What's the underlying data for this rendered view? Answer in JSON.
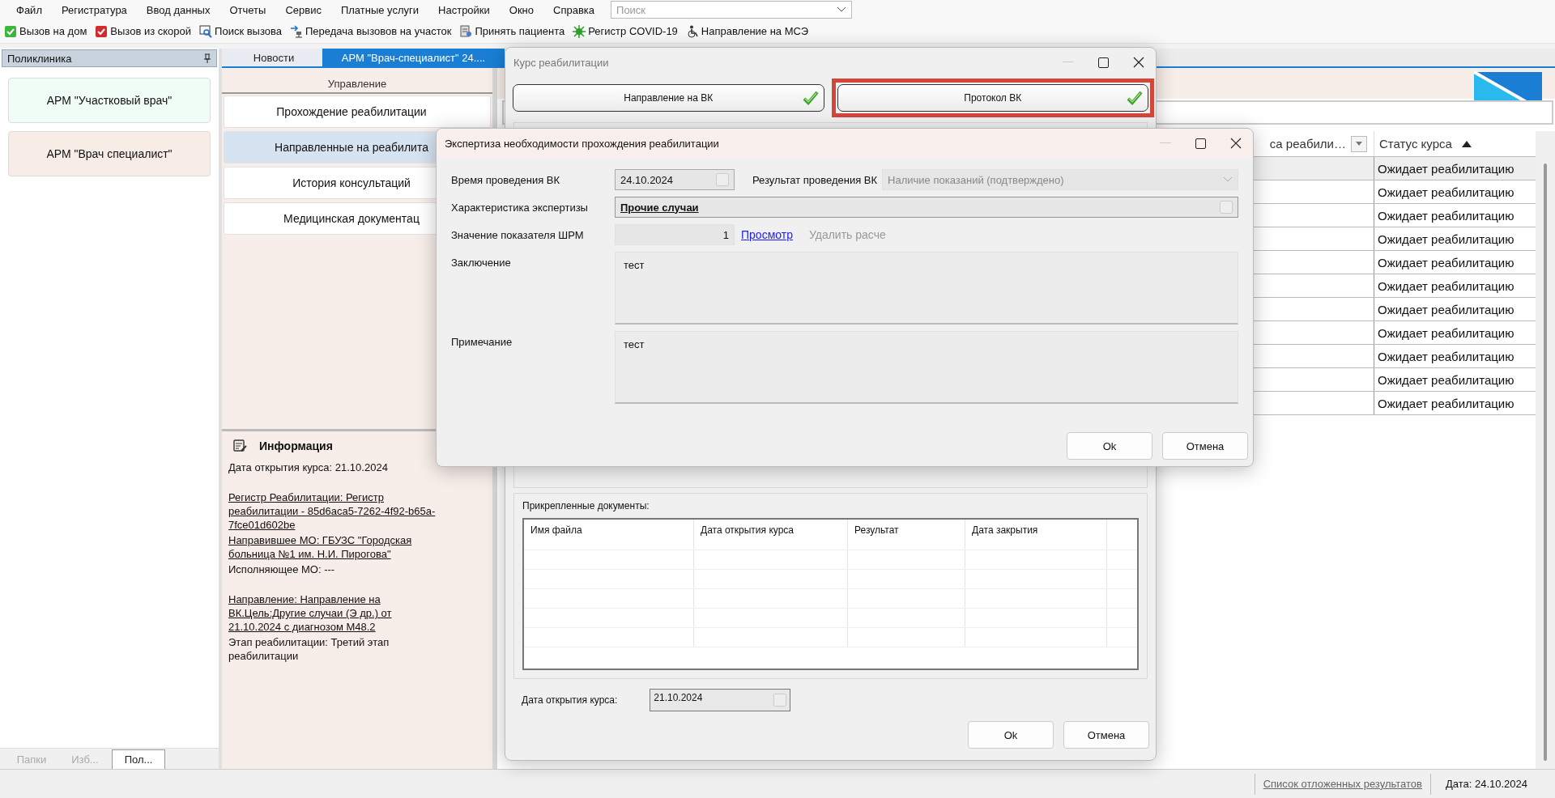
{
  "menu": [
    "Файл",
    "Регистратура",
    "Ввод данных",
    "Отчеты",
    "Сервис",
    "Платные услуги",
    "Настройки",
    "Окно",
    "Справка"
  ],
  "search": {
    "placeholder": "Поиск"
  },
  "toolbar": [
    {
      "label": "Вызов на дом",
      "kind": "green-check"
    },
    {
      "label": "Вызов из скорой",
      "kind": "red-check"
    },
    {
      "label": "Поиск вызова",
      "kind": "search"
    },
    {
      "label": "Передача вызовов на участок",
      "kind": "network"
    },
    {
      "label": "Принять пациента",
      "kind": "document"
    },
    {
      "label": "Регистр COVID-19",
      "kind": "virus"
    },
    {
      "label": "Направление на МСЭ",
      "kind": "person"
    }
  ],
  "left_panel": {
    "title": "Поликлиника",
    "workplaces": [
      {
        "label": "АРМ \"Участковый врач\"",
        "color": "#f0fcf6"
      },
      {
        "label": "АРМ \"Врач специалист\"",
        "color": "#f8ece7"
      }
    ],
    "bottom_tabs": [
      {
        "label": "Папки",
        "selected": false
      },
      {
        "label": "Изб...",
        "selected": false
      },
      {
        "label": "Пол...",
        "selected": true
      }
    ]
  },
  "doc_tabs": [
    {
      "label": "Новости",
      "selected": false
    },
    {
      "label": "АРМ \"Врач-специалист\" 24....",
      "selected": true
    }
  ],
  "management": {
    "title": "Управление",
    "items": [
      {
        "label": "Прохождение реабилитации",
        "selected": false
      },
      {
        "label": "Направленные на реабилита",
        "selected": true
      },
      {
        "label": "История консультаций",
        "selected": false
      },
      {
        "label": "Медицинская документац",
        "selected": false
      }
    ]
  },
  "info": {
    "title": "Информация",
    "groups": [
      {
        "entries": [
          {
            "text": "Дата открытия курса: 21.10.2024",
            "underlined": false
          }
        ]
      },
      {
        "entries": [
          {
            "text": "Регистр Реабилитации: Регистр реабилитации - 85d6aca5-7262-4f92-b65a-7fce01d602be",
            "underlined": true
          },
          {
            "text": "Направившее МО: ГБУЗС \"Городская больница №1 им. Н.И. Пирогова\"",
            "underlined": true
          },
          {
            "text": "Исполняющее МО: ---",
            "underlined": false
          }
        ]
      },
      {
        "entries": [
          {
            "text": "Направление: Направление на ВК.Цель:Другие случаи (Э др.) от 21.10.2024 с диагнозом M48.2",
            "underlined": true
          },
          {
            "text": "Этап реабилитации: Третий этап реабилитации",
            "underlined": false
          }
        ]
      }
    ]
  },
  "results_table": {
    "columns": [
      {
        "label": "са реабили…",
        "filter": true,
        "sorted": false
      },
      {
        "label": "Статус курса",
        "filter": false,
        "sorted": true
      }
    ],
    "rows": [
      {
        "status": "Ожидает реабилитацию",
        "selected": true
      },
      {
        "status": "Ожидает реабилитацию",
        "selected": false
      },
      {
        "status": "Ожидает реабилитацию",
        "selected": false
      },
      {
        "status": "Ожидает реабилитацию",
        "selected": false
      },
      {
        "status": "Ожидает реабилитацию",
        "selected": false
      },
      {
        "status": "Ожидает реабилитацию",
        "selected": false
      },
      {
        "status": "Ожидает реабилитацию",
        "selected": false
      },
      {
        "status": "Ожидает реабилитацию",
        "selected": false
      },
      {
        "status": "Ожидает реабилитацию",
        "selected": false
      },
      {
        "status": "Ожидает реабилитацию",
        "selected": false
      },
      {
        "status": "Ожидает реабилитацию",
        "selected": false
      }
    ]
  },
  "course_dialog": {
    "title": "Курс реабилитации",
    "steps": [
      {
        "label": "Направление на ВК",
        "done": true,
        "highlighted": false
      },
      {
        "label": "Протокол ВК",
        "done": true,
        "highlighted": true
      }
    ],
    "attachments": {
      "title": "Прикрепленные документы:",
      "columns": [
        "Имя файла",
        "Дата открытия курса",
        "Результат",
        "Дата закрытия"
      ]
    },
    "open_date": {
      "label": "Дата открытия курса:",
      "value": "21.10.2024"
    },
    "buttons": [
      "Ok",
      "Отмена"
    ]
  },
  "expertise_dialog": {
    "title": "Экспертиза необходимости прохождения реабилитации",
    "vk_time": {
      "label": "Время проведения ВК",
      "value": "24.10.2024"
    },
    "vk_result": {
      "label": "Результат проведения ВК",
      "value": "Наличие показаний (подтверждено)"
    },
    "characteristic": {
      "label": "Характеристика экспертизы",
      "value": "Прочие случаи"
    },
    "shrm": {
      "label": "Значение показателя ШРМ",
      "value": "1"
    },
    "view_link": "Просмотр",
    "delete_link": {
      "label": "Удалить расче",
      "disabled": true
    },
    "conclusion": {
      "label": "Заключение",
      "value": "тест"
    },
    "note": {
      "label": "Примечание",
      "value": "тест"
    },
    "buttons": [
      "Ok",
      "Отмена"
    ]
  },
  "status_bar": {
    "link": "Список отложенных результатов",
    "date": "Дата: 24.10.2024"
  }
}
